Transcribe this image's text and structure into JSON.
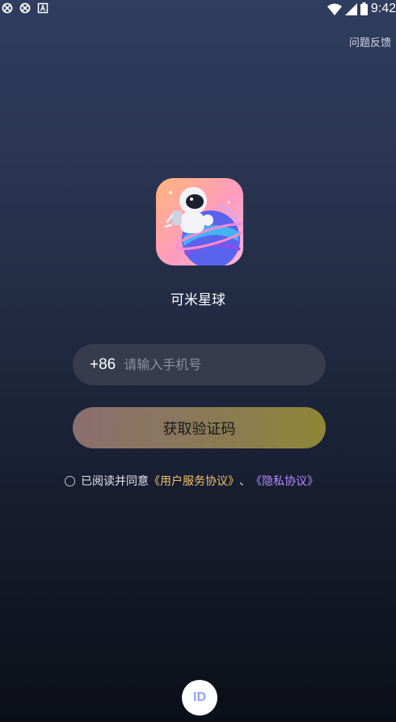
{
  "status_bar": {
    "time": "9:42",
    "left_icons": [
      "app-notification-icon",
      "app-notification-icon",
      "keyboard-notification-icon"
    ],
    "right_icons": [
      "wifi-icon",
      "cellular-signal-icon",
      "battery-icon"
    ]
  },
  "header": {
    "feedback_label": "问题反馈"
  },
  "app": {
    "name": "可米星球",
    "icon": "astronaut-planet-logo"
  },
  "login": {
    "country_code": "+86",
    "phone_placeholder": "请输入手机号",
    "phone_value": "",
    "get_code_label": "获取验证码"
  },
  "agreement": {
    "checked": false,
    "prefix": "已阅读并同意",
    "user_agreement": "《用户服务协议》",
    "separator": "、",
    "privacy_policy": "《隐私协议》"
  },
  "bottom": {
    "id_button_label": "ID"
  },
  "colors": {
    "background_top": "#2f3d5e",
    "background_bottom": "#0c0f18",
    "link_user": "#f2c46a",
    "link_privacy": "#b78bff",
    "button_gradient_start": "#8c6f70",
    "button_gradient_end": "#8f8638"
  }
}
